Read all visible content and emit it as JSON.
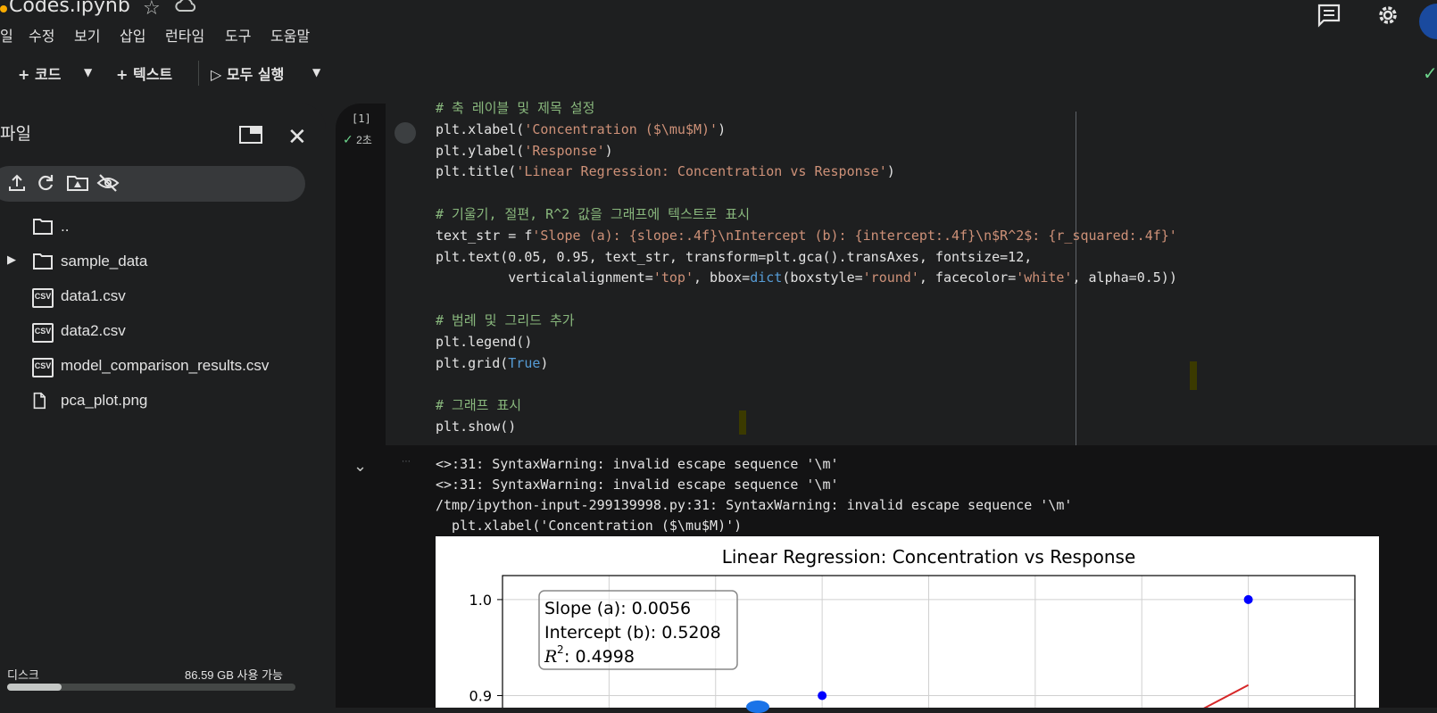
{
  "window": {
    "title": "Codes.ipynb"
  },
  "menu": [
    "일",
    "수정",
    "보기",
    "삽입",
    "런타임",
    "도구",
    "도움말"
  ],
  "toolbar": {
    "add_code": "+ 코드",
    "add_text": "+ 텍스트",
    "run_all": "▷ 모두 실행"
  },
  "sidebar": {
    "title": "파일",
    "files": [
      {
        "name": "..",
        "icon": "folder-icon"
      },
      {
        "name": "sample_data",
        "icon": "folder-icon"
      },
      {
        "name": "data1.csv",
        "icon": "csv-icon"
      },
      {
        "name": "data2.csv",
        "icon": "csv-icon"
      },
      {
        "name": "model_comparison_results.csv",
        "icon": "csv-icon"
      },
      {
        "name": "pca_plot.png",
        "icon": "file-icon"
      }
    ],
    "disk_label": "디스크",
    "disk_free": "86.59 GB 사용 가능",
    "disk_used_fraction": 0.19
  },
  "cell": {
    "exec_count": "[1]",
    "exec_time": "2초",
    "code_lines": [
      "# 축 레이블 및 제목 설정",
      "plt.xlabel('Concentration ($\\mu$M)')",
      "plt.ylabel('Response')",
      "plt.title('Linear Regression: Concentration vs Response')",
      "",
      "# 기울기, 절편, R^2 값을 그래프에 텍스트로 표시",
      "text_str = f'Slope (a): {slope:.4f}\\nIntercept (b): {intercept:.4f}\\n$R^2$: {r_squared:.4f}'",
      "plt.text(0.05, 0.95, text_str, transform=plt.gca().transAxes, fontsize=12,",
      "         verticalalignment='top', bbox=dict(boxstyle='round', facecolor='white', alpha=0.5))",
      "",
      "# 범례 및 그리드 추가",
      "plt.legend()",
      "plt.grid(True)",
      "",
      "# 그래프 표시",
      "plt.show()"
    ],
    "output_lines": [
      "<>:31: SyntaxWarning: invalid escape sequence '\\m'",
      "<>:31: SyntaxWarning: invalid escape sequence '\\m'",
      "/tmp/ipython-input-299139998.py:31: SyntaxWarning: invalid escape sequence '\\m'",
      "  plt.xlabel('Concentration ($\\mu$M)')"
    ]
  },
  "chart_data": {
    "type": "scatter",
    "title": "Linear Regression: Concentration vs Response",
    "ylim": [
      0.88,
      1.025
    ],
    "yticks": [
      "1.0",
      "0.9"
    ],
    "ytick_values": [
      1.0,
      0.9
    ],
    "xlim": [
      0,
      8
    ],
    "grid": true,
    "points": [
      {
        "x": 3,
        "y": 0.9
      },
      {
        "x": 7,
        "y": 1.0
      }
    ],
    "regression_line": {
      "x": [
        6.4,
        7
      ],
      "y": [
        0.876,
        0.911
      ]
    },
    "annotation": {
      "slope": "Slope (a): 0.0056",
      "intercept": "Intercept (b): 0.5208",
      "r2_label": "R",
      "r2_value": ": 0.4998"
    },
    "point_color": "#0000ff",
    "line_color": "#d62728"
  }
}
